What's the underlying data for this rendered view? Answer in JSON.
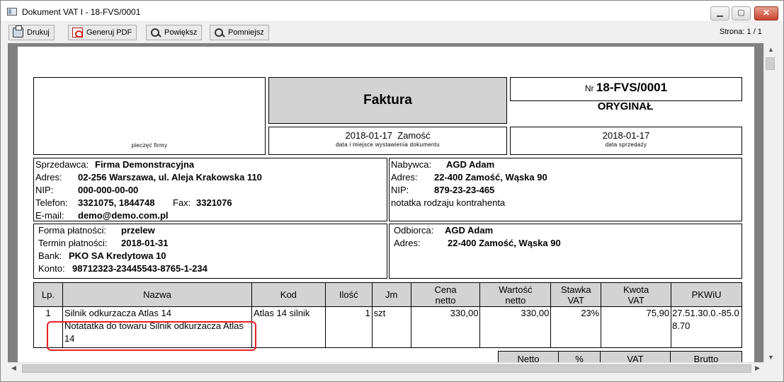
{
  "window": {
    "title": "Dokument VAT I - 18-FVS/0001",
    "min": "▁",
    "max": "▢",
    "close": "✕"
  },
  "toolbar": {
    "print": "Drukuj",
    "pdf": "Generuj PDF",
    "zoom_in": "Powiększ",
    "zoom_out": "Pomniejsz",
    "page_info": "Strona: 1 / 1"
  },
  "invoice": {
    "stamp_label": "pieczęć firmy",
    "doc_type": "Faktura",
    "nr_label": "Nr",
    "nr": "18-FVS/0001",
    "copy": "ORYGINAŁ",
    "issue_date_place": "2018-01-17  Zamość",
    "issue_caption": "data i miejsce wystawienia dokumentu",
    "sale_date": "2018-01-17",
    "sale_caption": "data sprzedaży",
    "seller": {
      "label": "Sprzedawca:",
      "name": "Firma Demonstracyjna",
      "addr_label": "Adres:",
      "addr": "02-256 Warszawa, ul. Aleja Krakowska 110",
      "nip_label": "NIP:",
      "nip": "000-000-00-00",
      "tel_label": "Telefon:",
      "tel": "3321075, 1844748",
      "fax_label": "Fax:",
      "fax": "3321076",
      "email_label": "E-mail:",
      "email": "demo@demo.com.pl"
    },
    "buyer": {
      "label": "Nabywca:",
      "name": "AGD Adam",
      "addr_label": "Adres:",
      "addr": "22-400 Zamość, Wąska 90",
      "nip_label": "NIP:",
      "nip": "879-23-23-465",
      "note": "notatka rodzaju kontrahenta"
    },
    "payment": {
      "form_label": "Forma płatności:",
      "form": "przelew",
      "term_label": "Termin płatności:",
      "term": "2018-01-31",
      "bank_label": "Bank:",
      "bank": "PKO SA Kredytowa 10",
      "account_label": "Konto:",
      "account": "98712323-23445543-8765-1-234"
    },
    "recipient": {
      "label": "Odbiorca:",
      "name": "AGD Adam",
      "addr_label": "Adres:",
      "addr": "22-400 Zamość, Wąska 90"
    },
    "table": {
      "headers": {
        "lp": "Lp.",
        "name": "Nazwa",
        "code": "Kod",
        "qty": "Ilość",
        "unit": "Jm",
        "price_1": "Cena",
        "price_2": "netto",
        "value_1": "Wartość",
        "value_2": "netto",
        "rate_1": "Stawka",
        "rate_2": "VAT",
        "vat_1": "Kwota",
        "vat_2": "VAT",
        "pkwiu": "PKWiU"
      },
      "rows": [
        {
          "lp": "1",
          "name": "Silnik odkurzacza Atlas 14",
          "note": "Notatatka do towaru Silnik odkurzacza Atlas 14",
          "code": "Atlas 14 silnik",
          "qty": "1",
          "unit": "szt",
          "price": "330,00",
          "value": "330,00",
          "rate": "23%",
          "vat": "75,90",
          "pkwiu": "27.51.30.0.-85.08.70"
        }
      ]
    },
    "summary_headers": {
      "netto": "Netto",
      "pct": "%",
      "vat": "VAT",
      "brutto": "Brutto"
    }
  }
}
